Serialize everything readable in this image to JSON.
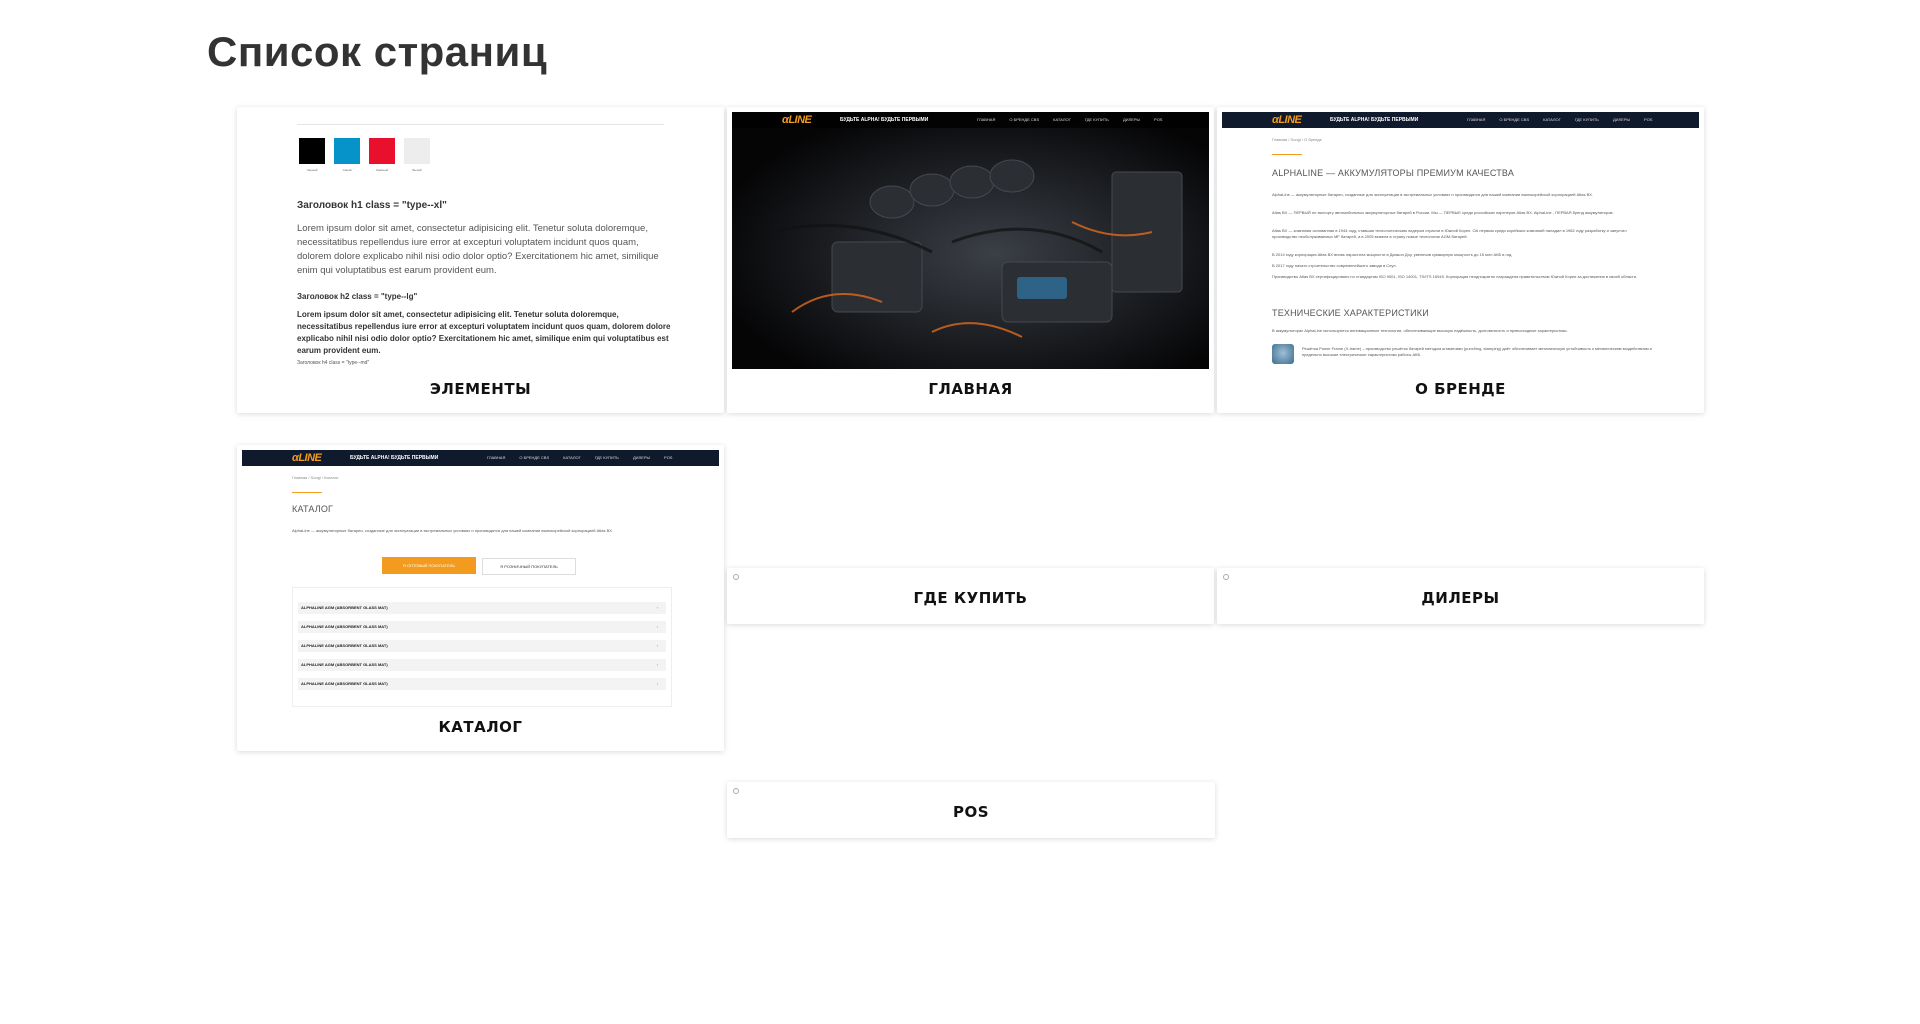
{
  "page": {
    "title": "Список страниц"
  },
  "cards": {
    "elements": {
      "caption": "ЭЛЕМЕНТЫ",
      "swatches": [
        {
          "color": "#000000",
          "label": "Черный"
        },
        {
          "color": "#0693c9",
          "label": "Синий"
        },
        {
          "color": "#e8102c",
          "label": "Красный"
        },
        {
          "color": "#ededed",
          "label": "Белый"
        }
      ],
      "h1_label": "Заголовок h1 class = \"type--xl\"",
      "p1": "Lorem ipsum dolor sit amet, consectetur adipisicing elit. Tenetur soluta doloremque, necessitatibus repellendus iure error at excepturi voluptatem incidunt quos quam, dolorem dolore explicabo nihil nisi odio dolor optio? Exercitationem hic amet, similique enim qui voluptatibus est earum provident eum.",
      "h2_label": "Заголовок h2 class = \"type--lg\"",
      "p2": "Lorem ipsum dolor sit amet, consectetur adipisicing elit. Tenetur soluta doloremque, necessitatibus repellendus iure error at excepturi voluptatem incidunt quos quam, dolorem dolore explicabo nihil nisi odio dolor optio? Exercitationem hic amet, similique enim qui voluptatibus est earum provident eum.",
      "h4_label": "Заголовок h4 class = \"type--md\""
    },
    "main": {
      "caption": "ГЛАВНАЯ",
      "logo": "αLINE",
      "tagline": "БУДЬТЕ ALPHA! БУДЬТЕ ПЕРВЫМИ",
      "nav": [
        "ГЛАВНАЯ",
        "О БРЕНДЕ CBS",
        "КАТАЛОГ",
        "ГДЕ КУПИТЬ",
        "ДИЛЕРЫ",
        "POS"
      ]
    },
    "about": {
      "caption": "О БРЕНДЕ",
      "logo": "αLINE",
      "tagline": "БУДЬТЕ ALPHA! БУДЬТЕ ПЕРВЫМИ",
      "nav": [
        "ГЛАВНАЯ",
        "О БРЕНДЕ CBS",
        "КАТАЛОГ",
        "ГДЕ КУПИТЬ",
        "ДИЛЕРЫ",
        "POS"
      ],
      "crumb": "Главная / Songl / О бренде",
      "heading": "ALPHALINE — АККУМУЛЯТОРЫ ПРЕМИУМ КАЧЕСТВА",
      "p1": "AlphaLine — аккумуляторные батареи, созданные для эксплуатации в экстремальных условиях и производятся для нашей компании южнокорейской корпорацией Atlas BX.",
      "p2": "Atlas BX — ПЕРВЫЙ по экспорту автомобильных аккумуляторных батарей в России. Мы — ПЕРВЫЕ среди российских партнеров Atlas BX. AlphaLine - ПЕРВАЯ бренд аккумуляторов.",
      "p3": "Atlas BX — компания основанная в 1944 году, ставшая технологическим лидером отрасли в Южной Корее. ОА первым среди корейских компаний наладил в 1982 году разработку и запустил производство необслуживаемых MF батарей, а в 2005 вывела в страну новые технологии AGM-батарей.",
      "p4": "В 2014 году корпорация Atlas BX вновь нарастила мощности в Даэжон Доу, увеличив суммарную мощность до 15 млн АКБ в год.",
      "p5": "В 2017 году начато строительство современейшего завода в Сеул.",
      "p6": "Производство Atlas BX сертифицировано по стандартам ISO 9001, ISO 14001, TS/ITS 16949. Корпорация неоднократно награждена правительством Южной Кореи за достижения в своей области.",
      "heading2": "ТЕХНИЧЕСКИЕ ХАРАКТЕРИСТИКИ",
      "p7": "В аккумуляторах AlphaLine используются инновационные технологии, обеспечивающие высокую надёжность, долговечность и превосходные характеристики.",
      "p8": "Решётка Power Frame (X-frame) – производство решёток батарей методом штамповки (punching, stamping) даёт обеспечивает механическую устойчивость к механическим воздействиям и предельно высокие электрические характеристики работы АКБ."
    },
    "catalog": {
      "caption": "КАТАЛОГ",
      "logo": "αLINE",
      "tagline": "БУДЬТЕ ALPHA! БУДЬТЕ ПЕРВЫМИ",
      "nav": [
        "ГЛАВНАЯ",
        "О БРЕНДЕ CBS",
        "КАТАЛОГ",
        "ГДЕ КУПИТЬ",
        "ДИЛЕРЫ",
        "POS"
      ],
      "crumb": "Главная / Songl / Каталог",
      "heading": "КАТАЛОГ",
      "intro": "AlphaLine — аккумуляторные батареи, созданные для эксплуатации в экстремальных условиях и производятся для нашей компании южнокорейской корпорацией Atlas BX.",
      "btn_primary": "Я ОПТОВЫЙ ПОКУПАТЕЛЬ",
      "btn_secondary": "Я РОЗНИЧНЫЙ ПОКУПАТЕЛЬ",
      "rows": [
        "ALPHALINE AGM (ABSORBENT GLASS MAT)",
        "ALPHALINE AGM (ABSORBENT GLASS MAT)",
        "ALPHALINE AGM (ABSORBENT GLASS MAT)",
        "ALPHALINE AGM (ABSORBENT GLASS MAT)",
        "ALPHALINE AGM (ABSORBENT GLASS MAT)"
      ]
    },
    "where_to_buy": {
      "caption": "ГДЕ КУПИТЬ"
    },
    "dealers": {
      "caption": "ДИЛЕРЫ"
    },
    "pos": {
      "caption": "POS"
    }
  }
}
